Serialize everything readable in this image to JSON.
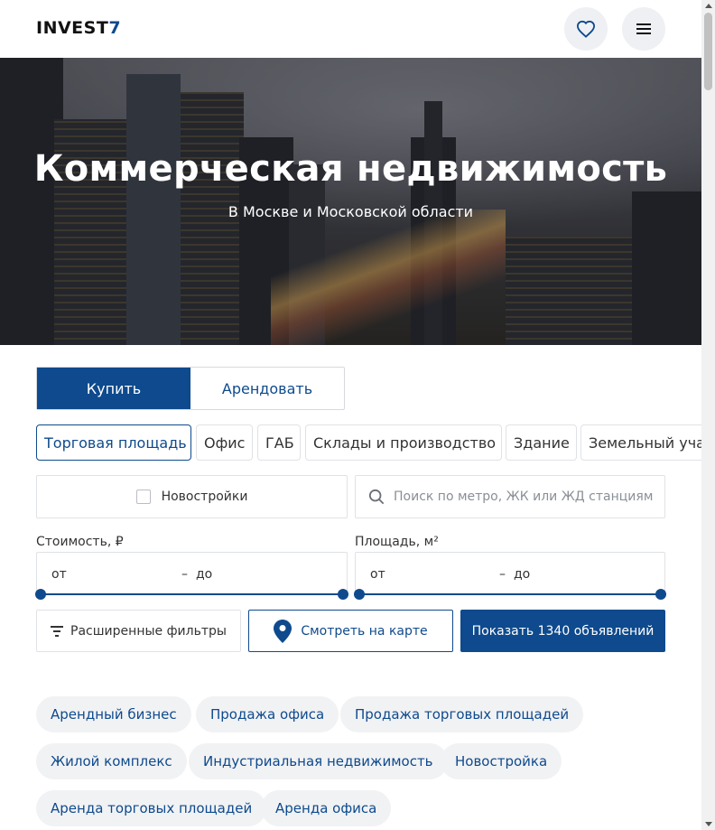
{
  "header": {
    "logo_main": "INVEST",
    "logo_accent": "7",
    "favorites_icon": "heart-icon",
    "menu_icon": "menu-icon"
  },
  "hero": {
    "title": "Коммерческая недвижимость",
    "subtitle": "В Москве и Московской области"
  },
  "deal": {
    "buy": "Купить",
    "rent": "Арендовать",
    "active": "buy"
  },
  "types": [
    "Торговая площадь",
    "Офис",
    "ГАБ",
    "Склады и производство",
    "Здание",
    "Земельный участок"
  ],
  "filters": {
    "newbuild_label": "Новостройки",
    "search_placeholder": "Поиск по метро, ЖК или ЖД станциям",
    "price_label": "Стоимость, ₽",
    "area_label": "Площадь, м²",
    "from": "от",
    "to": "до",
    "dash": "–",
    "advanced": "Расширенные фильтры",
    "map": "Смотреть на карте",
    "show": "Показать 1340 объявлений"
  },
  "chips": [
    "Арендный бизнес",
    "Продажа офиса",
    "Продажа торговых площадей",
    "Жилой комплекс",
    "Индустриальная недвижимость",
    "Новостройка",
    "Аренда торговых площадей",
    "Аренда офиса"
  ],
  "colors": {
    "brand": "#0e4a8d",
    "chip_bg": "#f1f2f4"
  }
}
